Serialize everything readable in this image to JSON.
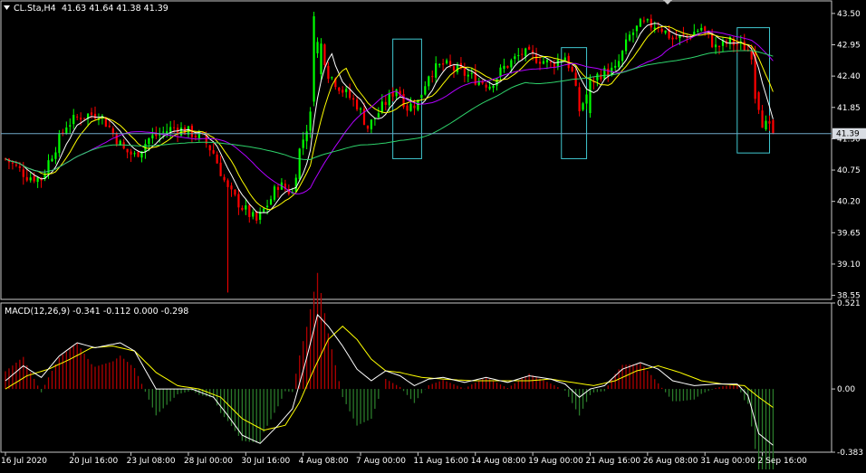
{
  "header": {
    "symbol_label": "CL.Sta,H4",
    "ohlc_text": "41.63 41.64 41.38 41.39"
  },
  "current_price_label": "41.39",
  "colors": {
    "background": "#000000",
    "grid_border": "#ffffff",
    "bull": "#00ff00",
    "bear": "#ff0000",
    "ma_fast": "#ffffff",
    "ma_mid": "#ffff00",
    "ma_slow": "#b000ff",
    "ma_long": "#2ed36b",
    "price_line": "#6fa8c8",
    "highlight_box": "#40c8d0",
    "macd_pos": "#b00000",
    "macd_neg": "#2a7a2a",
    "macd_line": "#ffffff",
    "signal_line": "#ffff00"
  },
  "macd_header": {
    "label": "MACD(12,26,9) -0.341 -0.112 0.000 -0.298"
  },
  "chart_data": [
    {
      "type": "candlestick",
      "name": "CL.Sta,H4",
      "y_ticks": [
        "43.50",
        "42.95",
        "42.40",
        "41.85",
        "41.30",
        "40.75",
        "40.20",
        "39.65",
        "39.10",
        "38.55"
      ],
      "ylim": [
        38.48,
        43.72
      ],
      "current_price": 41.39,
      "x_tick_labels": [
        "16 Jul 2020",
        "20 Jul 16:00",
        "23 Jul 08:00",
        "28 Jul 00:00",
        "30 Jul 16:00",
        "4 Aug 08:00",
        "7 Aug 00:00",
        "11 Aug 16:00",
        "14 Aug 08:00",
        "19 Aug 00:00",
        "21 Aug 16:00",
        "26 Aug 08:00",
        "31 Aug 00:00",
        "2 Sep 16:00"
      ],
      "x_tick_index": [
        0,
        19,
        35,
        51,
        67,
        83,
        99,
        115,
        131,
        147,
        163,
        179,
        195,
        211
      ],
      "anchors": [
        [
          0,
          40.95
        ],
        [
          6,
          40.65
        ],
        [
          10,
          40.6
        ],
        [
          12,
          40.9
        ],
        [
          17,
          41.55
        ],
        [
          21,
          41.7
        ],
        [
          26,
          41.75
        ],
        [
          29,
          41.5
        ],
        [
          33,
          41.1
        ],
        [
          36,
          41.0
        ],
        [
          40,
          41.3
        ],
        [
          47,
          41.5
        ],
        [
          52,
          41.4
        ],
        [
          55,
          41.3
        ],
        [
          58,
          41.05
        ],
        [
          62,
          40.4
        ],
        [
          66,
          40.1
        ],
        [
          70,
          39.85
        ],
        [
          74,
          40.25
        ],
        [
          76,
          40.5
        ],
        [
          80,
          40.35
        ],
        [
          82,
          41.1
        ],
        [
          86,
          41.9
        ],
        [
          88,
          42.95
        ],
        [
          90,
          42.45
        ],
        [
          94,
          42.15
        ],
        [
          98,
          41.9
        ],
        [
          101,
          41.5
        ],
        [
          105,
          41.85
        ],
        [
          109,
          42.2
        ],
        [
          112,
          41.85
        ],
        [
          115,
          41.95
        ],
        [
          118,
          42.45
        ],
        [
          122,
          42.6
        ],
        [
          126,
          42.5
        ],
        [
          131,
          42.35
        ],
        [
          135,
          42.25
        ],
        [
          139,
          42.55
        ],
        [
          144,
          42.8
        ],
        [
          149,
          42.7
        ],
        [
          152,
          42.6
        ],
        [
          156,
          42.75
        ],
        [
          158,
          42.45
        ],
        [
          160,
          41.8
        ],
        [
          164,
          42.35
        ],
        [
          166,
          42.45
        ],
        [
          170,
          42.5
        ],
        [
          174,
          43.1
        ],
        [
          177,
          43.3
        ],
        [
          182,
          43.3
        ],
        [
          186,
          43.05
        ],
        [
          190,
          43.1
        ],
        [
          194,
          43.25
        ],
        [
          198,
          42.9
        ],
        [
          202,
          43.0
        ],
        [
          206,
          42.9
        ],
        [
          208,
          42.8
        ],
        [
          209,
          42.2
        ],
        [
          211,
          41.6
        ],
        [
          214,
          41.39
        ]
      ],
      "big_moves": [
        [
          86,
          41.95,
          43.45
        ],
        [
          87,
          42.8,
          43.0
        ],
        [
          163,
          41.75,
          42.35
        ],
        [
          209,
          42.85,
          42.0
        ]
      ],
      "wick_spikes": [
        [
          62,
          38.6
        ]
      ],
      "moving_averages": [
        {
          "name": "MA fast",
          "color_key": "ma_fast",
          "period": 6
        },
        {
          "name": "MA mid",
          "color_key": "ma_mid",
          "period": 10
        },
        {
          "name": "MA slow",
          "color_key": "ma_slow",
          "period": 24
        },
        {
          "name": "MA long",
          "color_key": "ma_long",
          "period": 60
        }
      ],
      "highlight_boxes": [
        {
          "bars": [
            109,
            115
          ],
          "ylim": [
            40.95,
            43.05
          ]
        },
        {
          "bars": [
            156,
            161
          ],
          "ylim": [
            40.95,
            42.9
          ]
        },
        {
          "bars": [
            205,
            212
          ],
          "ylim": [
            41.05,
            43.25
          ]
        }
      ]
    },
    {
      "type": "macd",
      "name": "MACD(12,26,9)",
      "y_ticks": [
        "0.521",
        "0.00",
        "-0.383"
      ],
      "ylim": [
        -0.383,
        0.521
      ],
      "params": [
        12,
        26,
        9
      ],
      "values": {
        "main": -0.341,
        "signal": -0.112,
        "hist": -0.298
      },
      "anchors_main": [
        [
          0,
          0.05
        ],
        [
          5,
          0.14
        ],
        [
          10,
          0.07
        ],
        [
          15,
          0.2
        ],
        [
          20,
          0.28
        ],
        [
          25,
          0.25
        ],
        [
          32,
          0.28
        ],
        [
          36,
          0.23
        ],
        [
          42,
          0.0
        ],
        [
          46,
          -0.0
        ],
        [
          52,
          0.0
        ],
        [
          58,
          -0.05
        ],
        [
          62,
          -0.16
        ],
        [
          66,
          -0.28
        ],
        [
          71,
          -0.33
        ],
        [
          76,
          -0.22
        ],
        [
          80,
          -0.12
        ],
        [
          84,
          0.19
        ],
        [
          87,
          0.45
        ],
        [
          90,
          0.38
        ],
        [
          94,
          0.26
        ],
        [
          98,
          0.12
        ],
        [
          102,
          0.05
        ],
        [
          106,
          0.11
        ],
        [
          110,
          0.08
        ],
        [
          114,
          0.02
        ],
        [
          118,
          0.06
        ],
        [
          122,
          0.07
        ],
        [
          128,
          0.04
        ],
        [
          134,
          0.07
        ],
        [
          140,
          0.04
        ],
        [
          146,
          0.08
        ],
        [
          152,
          0.06
        ],
        [
          156,
          0.03
        ],
        [
          160,
          -0.05
        ],
        [
          163,
          0.0
        ],
        [
          167,
          0.02
        ],
        [
          172,
          0.12
        ],
        [
          177,
          0.16
        ],
        [
          182,
          0.12
        ],
        [
          186,
          0.05
        ],
        [
          192,
          0.02
        ],
        [
          198,
          0.03
        ],
        [
          204,
          0.03
        ],
        [
          207,
          -0.04
        ],
        [
          210,
          -0.27
        ],
        [
          214,
          -0.341
        ]
      ],
      "anchors_signal": [
        [
          0,
          0.0
        ],
        [
          6,
          0.08
        ],
        [
          12,
          0.12
        ],
        [
          18,
          0.18
        ],
        [
          24,
          0.25
        ],
        [
          30,
          0.26
        ],
        [
          36,
          0.23
        ],
        [
          42,
          0.1
        ],
        [
          48,
          0.02
        ],
        [
          54,
          0.0
        ],
        [
          60,
          -0.05
        ],
        [
          66,
          -0.18
        ],
        [
          72,
          -0.25
        ],
        [
          78,
          -0.22
        ],
        [
          82,
          -0.08
        ],
        [
          86,
          0.12
        ],
        [
          90,
          0.3
        ],
        [
          94,
          0.38
        ],
        [
          98,
          0.3
        ],
        [
          102,
          0.18
        ],
        [
          106,
          0.11
        ],
        [
          110,
          0.1
        ],
        [
          116,
          0.07
        ],
        [
          122,
          0.06
        ],
        [
          130,
          0.05
        ],
        [
          138,
          0.05
        ],
        [
          146,
          0.05
        ],
        [
          152,
          0.06
        ],
        [
          158,
          0.04
        ],
        [
          164,
          0.02
        ],
        [
          170,
          0.05
        ],
        [
          176,
          0.11
        ],
        [
          182,
          0.14
        ],
        [
          188,
          0.1
        ],
        [
          194,
          0.05
        ],
        [
          200,
          0.03
        ],
        [
          206,
          0.02
        ],
        [
          210,
          -0.05
        ],
        [
          214,
          -0.112
        ]
      ]
    }
  ]
}
